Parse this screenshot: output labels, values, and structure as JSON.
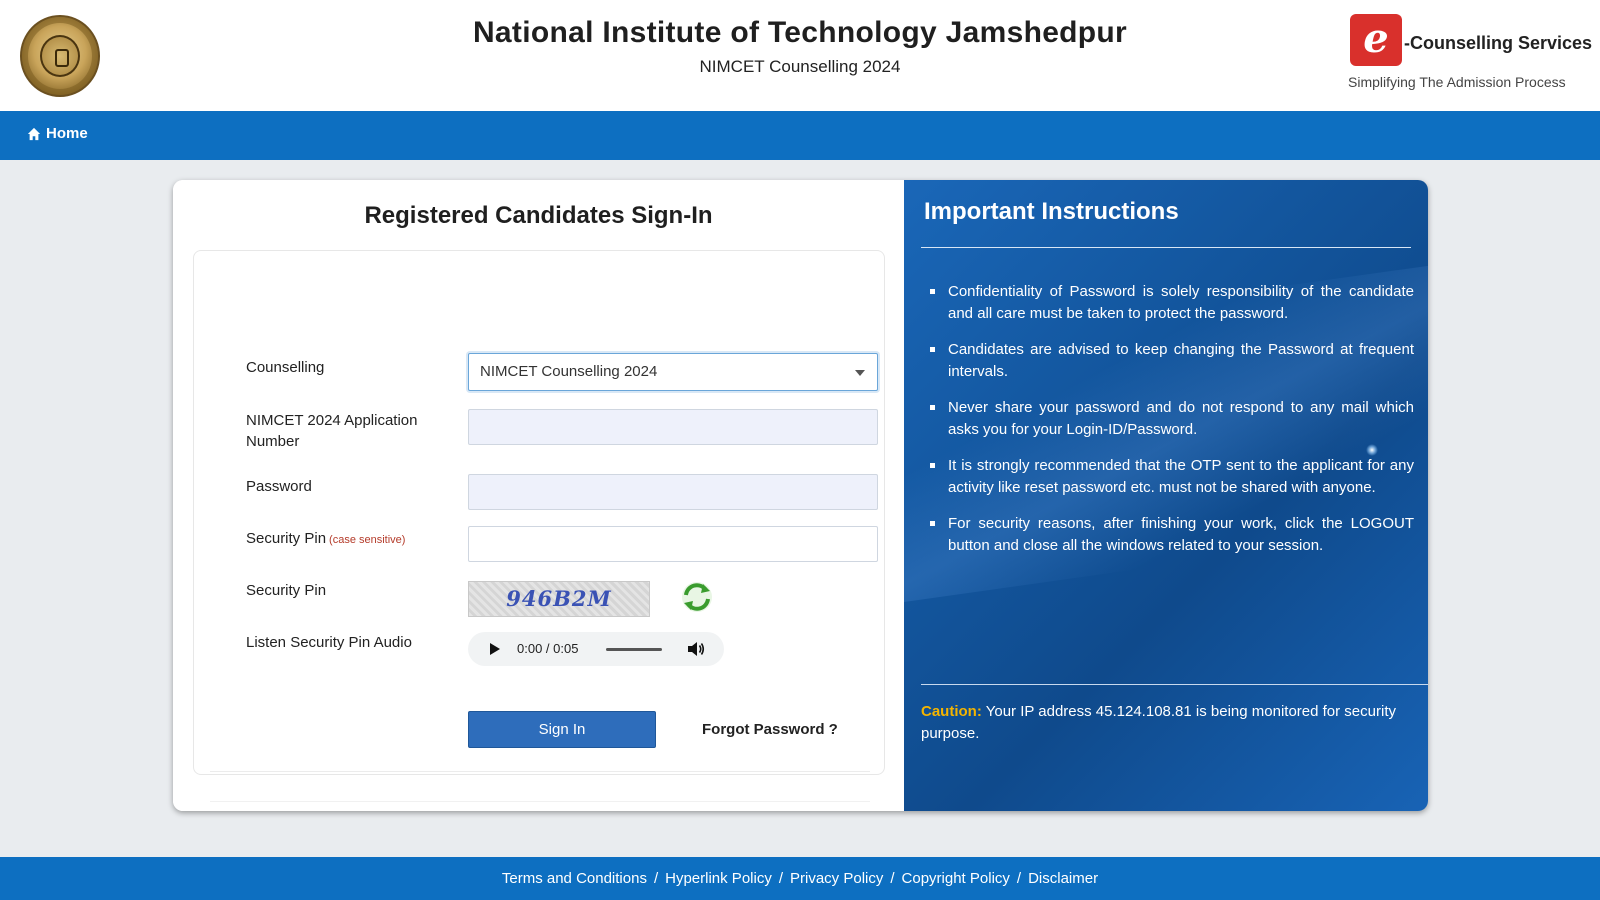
{
  "header": {
    "title": "National Institute of Technology Jamshedpur",
    "subtitle": "NIMCET Counselling 2024",
    "brand_mark": "e",
    "brand_name": "-Counselling Services",
    "brand_tagline": "Simplifying The Admission Process"
  },
  "nav": {
    "home_label": "Home"
  },
  "signin": {
    "title": "Registered Candidates Sign-In",
    "counselling_label": "Counselling",
    "counselling_value": "NIMCET Counselling 2024",
    "application_label": "NIMCET 2024 Application Number",
    "application_value": "",
    "password_label": "Password",
    "password_value": "",
    "security_pin_label": "Security Pin",
    "security_pin_hint": "(case sensitive)",
    "security_pin_value": "",
    "captcha_label": "Security Pin",
    "captcha_text": "946B2M",
    "audio_label": "Listen Security Pin Audio",
    "audio_time": "0:00 / 0:05",
    "signin_button": "Sign In",
    "forgot_link": "Forgot Password ?"
  },
  "instructions": {
    "title": "Important Instructions",
    "items": [
      "Confidentiality of Password is solely responsibility of the candidate and all care must be taken to protect the password.",
      "Candidates are advised to keep changing the Password at frequent intervals.",
      "Never share your password and do not respond to any mail which asks you for your Login-ID/Password.",
      "It is strongly recommended that the OTP sent to the applicant for any activity like reset password etc. must not be shared with anyone.",
      "For security reasons, after finishing your work, click the LOGOUT button and close all the windows related to your session."
    ],
    "caution_label": "Caution:",
    "caution_text": " Your IP address 45.124.108.81 is being monitored for security purpose."
  },
  "footer": {
    "links": [
      "Terms and Conditions",
      "Hyperlink Policy",
      "Privacy Policy",
      "Copyright Policy",
      "Disclaimer"
    ],
    "separator": "/"
  },
  "colors": {
    "nav_blue": "#0d6fc1",
    "button_blue": "#2e6dbb",
    "caution_orange": "#f4b400",
    "brand_red": "#d9302c"
  },
  "icons": {
    "nav_home": "home-icon",
    "refresh": "refresh-icon",
    "play": "play-icon",
    "volume": "volume-icon",
    "dropdown": "chevron-down-icon"
  }
}
